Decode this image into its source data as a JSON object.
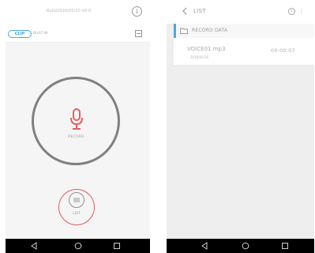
{
  "left_screen": {
    "header": {
      "build_text": "Build2016/05/20 V0.6",
      "info_glyph": "i"
    },
    "input_toggle": {
      "selected": "CLIP",
      "other": "BUILT IN"
    },
    "record": {
      "label": "RECORD"
    },
    "list": {
      "label": "LIST"
    }
  },
  "right_screen": {
    "header": {
      "title": "LIST",
      "info_glyph": "i",
      "menu_glyph": "⋮"
    },
    "folder": {
      "label": "RECORD DATA"
    },
    "files": [
      {
        "name": "VOICE01.mp3",
        "date": "2016/05/16",
        "duration": "00:00:07"
      }
    ]
  },
  "navbar": {
    "icons": [
      "back-icon",
      "home-icon",
      "recents-icon"
    ]
  },
  "colors": {
    "accent_blue": "#4aa9de",
    "record_red": "#e06060",
    "ring_gray": "#808080",
    "navbar": "#000000"
  }
}
